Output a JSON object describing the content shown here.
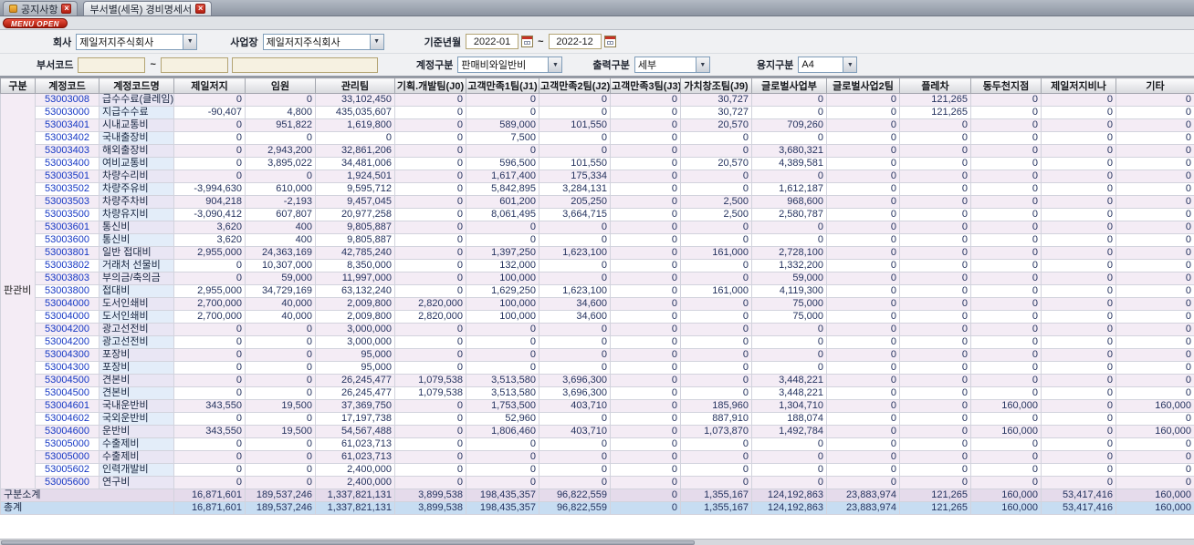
{
  "tabs": [
    {
      "label": "공지사항"
    },
    {
      "label": "부서별(세목) 경비명세서"
    }
  ],
  "menu_open_label": "MENU OPEN",
  "filters": {
    "company_label": "회사",
    "company_value": "제일저지주식회사",
    "workplace_label": "사업장",
    "workplace_value": "제일저지주식회사",
    "period_label": "기준년월",
    "period_from": "2022-01",
    "period_to": "2022-12",
    "tilde": "~",
    "dept_code_label": "부서코드",
    "dept_code_from": "",
    "dept_code_to": "",
    "dept_name": "",
    "account_type_label": "계정구분",
    "account_type_value": "판매비와일반비",
    "output_type_label": "출력구분",
    "output_type_value": "세부",
    "paper_type_label": "용지구분",
    "paper_type_value": "A4"
  },
  "grid": {
    "headers": [
      "구분",
      "계정코드",
      "계정코드명",
      "제일저지",
      "임원",
      "관리팀",
      "기획.개발팀(J0)",
      "고객만족1팀(J1)",
      "고객만족2팀(J2)",
      "고객만족3팀(J3)",
      "가치창조팀(J9)",
      "글로벌사업부",
      "글로벌사업2팀",
      "플레차",
      "동두천지점",
      "제일저지비나",
      "기타"
    ],
    "group_label": "판관비",
    "rows": [
      {
        "code": "53003008",
        "name": "급수수료(클레임)",
        "values": [
          "0",
          "0",
          "33,102,450",
          "0",
          "0",
          "0",
          "0",
          "30,727",
          "0",
          "0",
          "121,265",
          "0",
          "0",
          "0"
        ]
      },
      {
        "code": "53003000",
        "name": "지급수수료",
        "values": [
          "-90,407",
          "4,800",
          "435,035,607",
          "0",
          "0",
          "0",
          "0",
          "30,727",
          "0",
          "0",
          "121,265",
          "0",
          "0",
          "0"
        ]
      },
      {
        "code": "53003401",
        "name": "시내교통비",
        "values": [
          "0",
          "951,822",
          "1,619,800",
          "0",
          "589,000",
          "101,550",
          "0",
          "20,570",
          "709,260",
          "0",
          "0",
          "0",
          "0",
          "0"
        ]
      },
      {
        "code": "53003402",
        "name": "국내출장비",
        "values": [
          "0",
          "0",
          "0",
          "0",
          "7,500",
          "0",
          "0",
          "0",
          "0",
          "0",
          "0",
          "0",
          "0",
          "0"
        ]
      },
      {
        "code": "53003403",
        "name": "해외출장비",
        "values": [
          "0",
          "2,943,200",
          "32,861,206",
          "0",
          "0",
          "0",
          "0",
          "0",
          "3,680,321",
          "0",
          "0",
          "0",
          "0",
          "0"
        ]
      },
      {
        "code": "53003400",
        "name": "여비교통비",
        "values": [
          "0",
          "3,895,022",
          "34,481,006",
          "0",
          "596,500",
          "101,550",
          "0",
          "20,570",
          "4,389,581",
          "0",
          "0",
          "0",
          "0",
          "0"
        ]
      },
      {
        "code": "53003501",
        "name": "차량수리비",
        "values": [
          "0",
          "0",
          "1,924,501",
          "0",
          "1,617,400",
          "175,334",
          "0",
          "0",
          "0",
          "0",
          "0",
          "0",
          "0",
          "0"
        ]
      },
      {
        "code": "53003502",
        "name": "차량주유비",
        "values": [
          "-3,994,630",
          "610,000",
          "9,595,712",
          "0",
          "5,842,895",
          "3,284,131",
          "0",
          "0",
          "1,612,187",
          "0",
          "0",
          "0",
          "0",
          "0"
        ]
      },
      {
        "code": "53003503",
        "name": "차량주차비",
        "values": [
          "904,218",
          "-2,193",
          "9,457,045",
          "0",
          "601,200",
          "205,250",
          "0",
          "2,500",
          "968,600",
          "0",
          "0",
          "0",
          "0",
          "0"
        ]
      },
      {
        "code": "53003500",
        "name": "차량유지비",
        "values": [
          "-3,090,412",
          "607,807",
          "20,977,258",
          "0",
          "8,061,495",
          "3,664,715",
          "0",
          "2,500",
          "2,580,787",
          "0",
          "0",
          "0",
          "0",
          "0"
        ]
      },
      {
        "code": "53003601",
        "name": "통신비",
        "values": [
          "3,620",
          "400",
          "9,805,887",
          "0",
          "0",
          "0",
          "0",
          "0",
          "0",
          "0",
          "0",
          "0",
          "0",
          "0"
        ]
      },
      {
        "code": "53003600",
        "name": "통신비",
        "values": [
          "3,620",
          "400",
          "9,805,887",
          "0",
          "0",
          "0",
          "0",
          "0",
          "0",
          "0",
          "0",
          "0",
          "0",
          "0"
        ]
      },
      {
        "code": "53003801",
        "name": "일반 접대비",
        "values": [
          "2,955,000",
          "24,363,169",
          "42,785,240",
          "0",
          "1,397,250",
          "1,623,100",
          "0",
          "161,000",
          "2,728,100",
          "0",
          "0",
          "0",
          "0",
          "0"
        ]
      },
      {
        "code": "53003802",
        "name": "거래처 선물비",
        "values": [
          "0",
          "10,307,000",
          "8,350,000",
          "0",
          "132,000",
          "0",
          "0",
          "0",
          "1,332,200",
          "0",
          "0",
          "0",
          "0",
          "0"
        ]
      },
      {
        "code": "53003803",
        "name": "부의금/축의금",
        "values": [
          "0",
          "59,000",
          "11,997,000",
          "0",
          "100,000",
          "0",
          "0",
          "0",
          "59,000",
          "0",
          "0",
          "0",
          "0",
          "0"
        ]
      },
      {
        "code": "53003800",
        "name": "접대비",
        "values": [
          "2,955,000",
          "34,729,169",
          "63,132,240",
          "0",
          "1,629,250",
          "1,623,100",
          "0",
          "161,000",
          "4,119,300",
          "0",
          "0",
          "0",
          "0",
          "0"
        ]
      },
      {
        "code": "53004000",
        "name": "도서인쇄비",
        "values": [
          "2,700,000",
          "40,000",
          "2,009,800",
          "2,820,000",
          "100,000",
          "34,600",
          "0",
          "0",
          "75,000",
          "0",
          "0",
          "0",
          "0",
          "0"
        ]
      },
      {
        "code": "53004000",
        "name": "도서인쇄비",
        "values": [
          "2,700,000",
          "40,000",
          "2,009,800",
          "2,820,000",
          "100,000",
          "34,600",
          "0",
          "0",
          "75,000",
          "0",
          "0",
          "0",
          "0",
          "0"
        ]
      },
      {
        "code": "53004200",
        "name": "광고선전비",
        "values": [
          "0",
          "0",
          "3,000,000",
          "0",
          "0",
          "0",
          "0",
          "0",
          "0",
          "0",
          "0",
          "0",
          "0",
          "0"
        ]
      },
      {
        "code": "53004200",
        "name": "광고선전비",
        "values": [
          "0",
          "0",
          "3,000,000",
          "0",
          "0",
          "0",
          "0",
          "0",
          "0",
          "0",
          "0",
          "0",
          "0",
          "0"
        ]
      },
      {
        "code": "53004300",
        "name": "포장비",
        "values": [
          "0",
          "0",
          "95,000",
          "0",
          "0",
          "0",
          "0",
          "0",
          "0",
          "0",
          "0",
          "0",
          "0",
          "0"
        ]
      },
      {
        "code": "53004300",
        "name": "포장비",
        "values": [
          "0",
          "0",
          "95,000",
          "0",
          "0",
          "0",
          "0",
          "0",
          "0",
          "0",
          "0",
          "0",
          "0",
          "0"
        ]
      },
      {
        "code": "53004500",
        "name": "견본비",
        "values": [
          "0",
          "0",
          "26,245,477",
          "1,079,538",
          "3,513,580",
          "3,696,300",
          "0",
          "0",
          "3,448,221",
          "0",
          "0",
          "0",
          "0",
          "0"
        ]
      },
      {
        "code": "53004500",
        "name": "견본비",
        "values": [
          "0",
          "0",
          "26,245,477",
          "1,079,538",
          "3,513,580",
          "3,696,300",
          "0",
          "0",
          "3,448,221",
          "0",
          "0",
          "0",
          "0",
          "0"
        ]
      },
      {
        "code": "53004601",
        "name": "국내운반비",
        "values": [
          "343,550",
          "19,500",
          "37,369,750",
          "0",
          "1,753,500",
          "403,710",
          "0",
          "185,960",
          "1,304,710",
          "0",
          "0",
          "160,000",
          "0",
          "160,000"
        ]
      },
      {
        "code": "53004602",
        "name": "국외운반비",
        "values": [
          "0",
          "0",
          "17,197,738",
          "0",
          "52,960",
          "0",
          "0",
          "887,910",
          "188,074",
          "0",
          "0",
          "0",
          "0",
          "0"
        ]
      },
      {
        "code": "53004600",
        "name": "운반비",
        "values": [
          "343,550",
          "19,500",
          "54,567,488",
          "0",
          "1,806,460",
          "403,710",
          "0",
          "1,073,870",
          "1,492,784",
          "0",
          "0",
          "160,000",
          "0",
          "160,000"
        ]
      },
      {
        "code": "53005000",
        "name": "수출제비",
        "values": [
          "0",
          "0",
          "61,023,713",
          "0",
          "0",
          "0",
          "0",
          "0",
          "0",
          "0",
          "0",
          "0",
          "0",
          "0"
        ]
      },
      {
        "code": "53005000",
        "name": "수출제비",
        "values": [
          "0",
          "0",
          "61,023,713",
          "0",
          "0",
          "0",
          "0",
          "0",
          "0",
          "0",
          "0",
          "0",
          "0",
          "0"
        ]
      },
      {
        "code": "53005602",
        "name": "인력개발비",
        "values": [
          "0",
          "0",
          "2,400,000",
          "0",
          "0",
          "0",
          "0",
          "0",
          "0",
          "0",
          "0",
          "0",
          "0",
          "0"
        ]
      },
      {
        "code": "53005600",
        "name": "연구비",
        "values": [
          "0",
          "0",
          "2,400,000",
          "0",
          "0",
          "0",
          "0",
          "0",
          "0",
          "0",
          "0",
          "0",
          "0",
          "0"
        ]
      }
    ],
    "subtotal": {
      "label": "구분소계",
      "values": [
        "16,871,601",
        "189,537,246",
        "1,337,821,131",
        "3,899,538",
        "198,435,357",
        "96,822,559",
        "0",
        "1,355,167",
        "124,192,863",
        "23,883,974",
        "121,265",
        "160,000",
        "53,417,416",
        "160,000"
      ]
    },
    "total": {
      "label": "총계",
      "values": [
        "16,871,601",
        "189,537,246",
        "1,337,821,131",
        "3,899,538",
        "198,435,357",
        "96,822,559",
        "0",
        "1,355,167",
        "124,192,863",
        "23,883,974",
        "121,265",
        "160,000",
        "53,417,416",
        "160,000"
      ]
    }
  }
}
